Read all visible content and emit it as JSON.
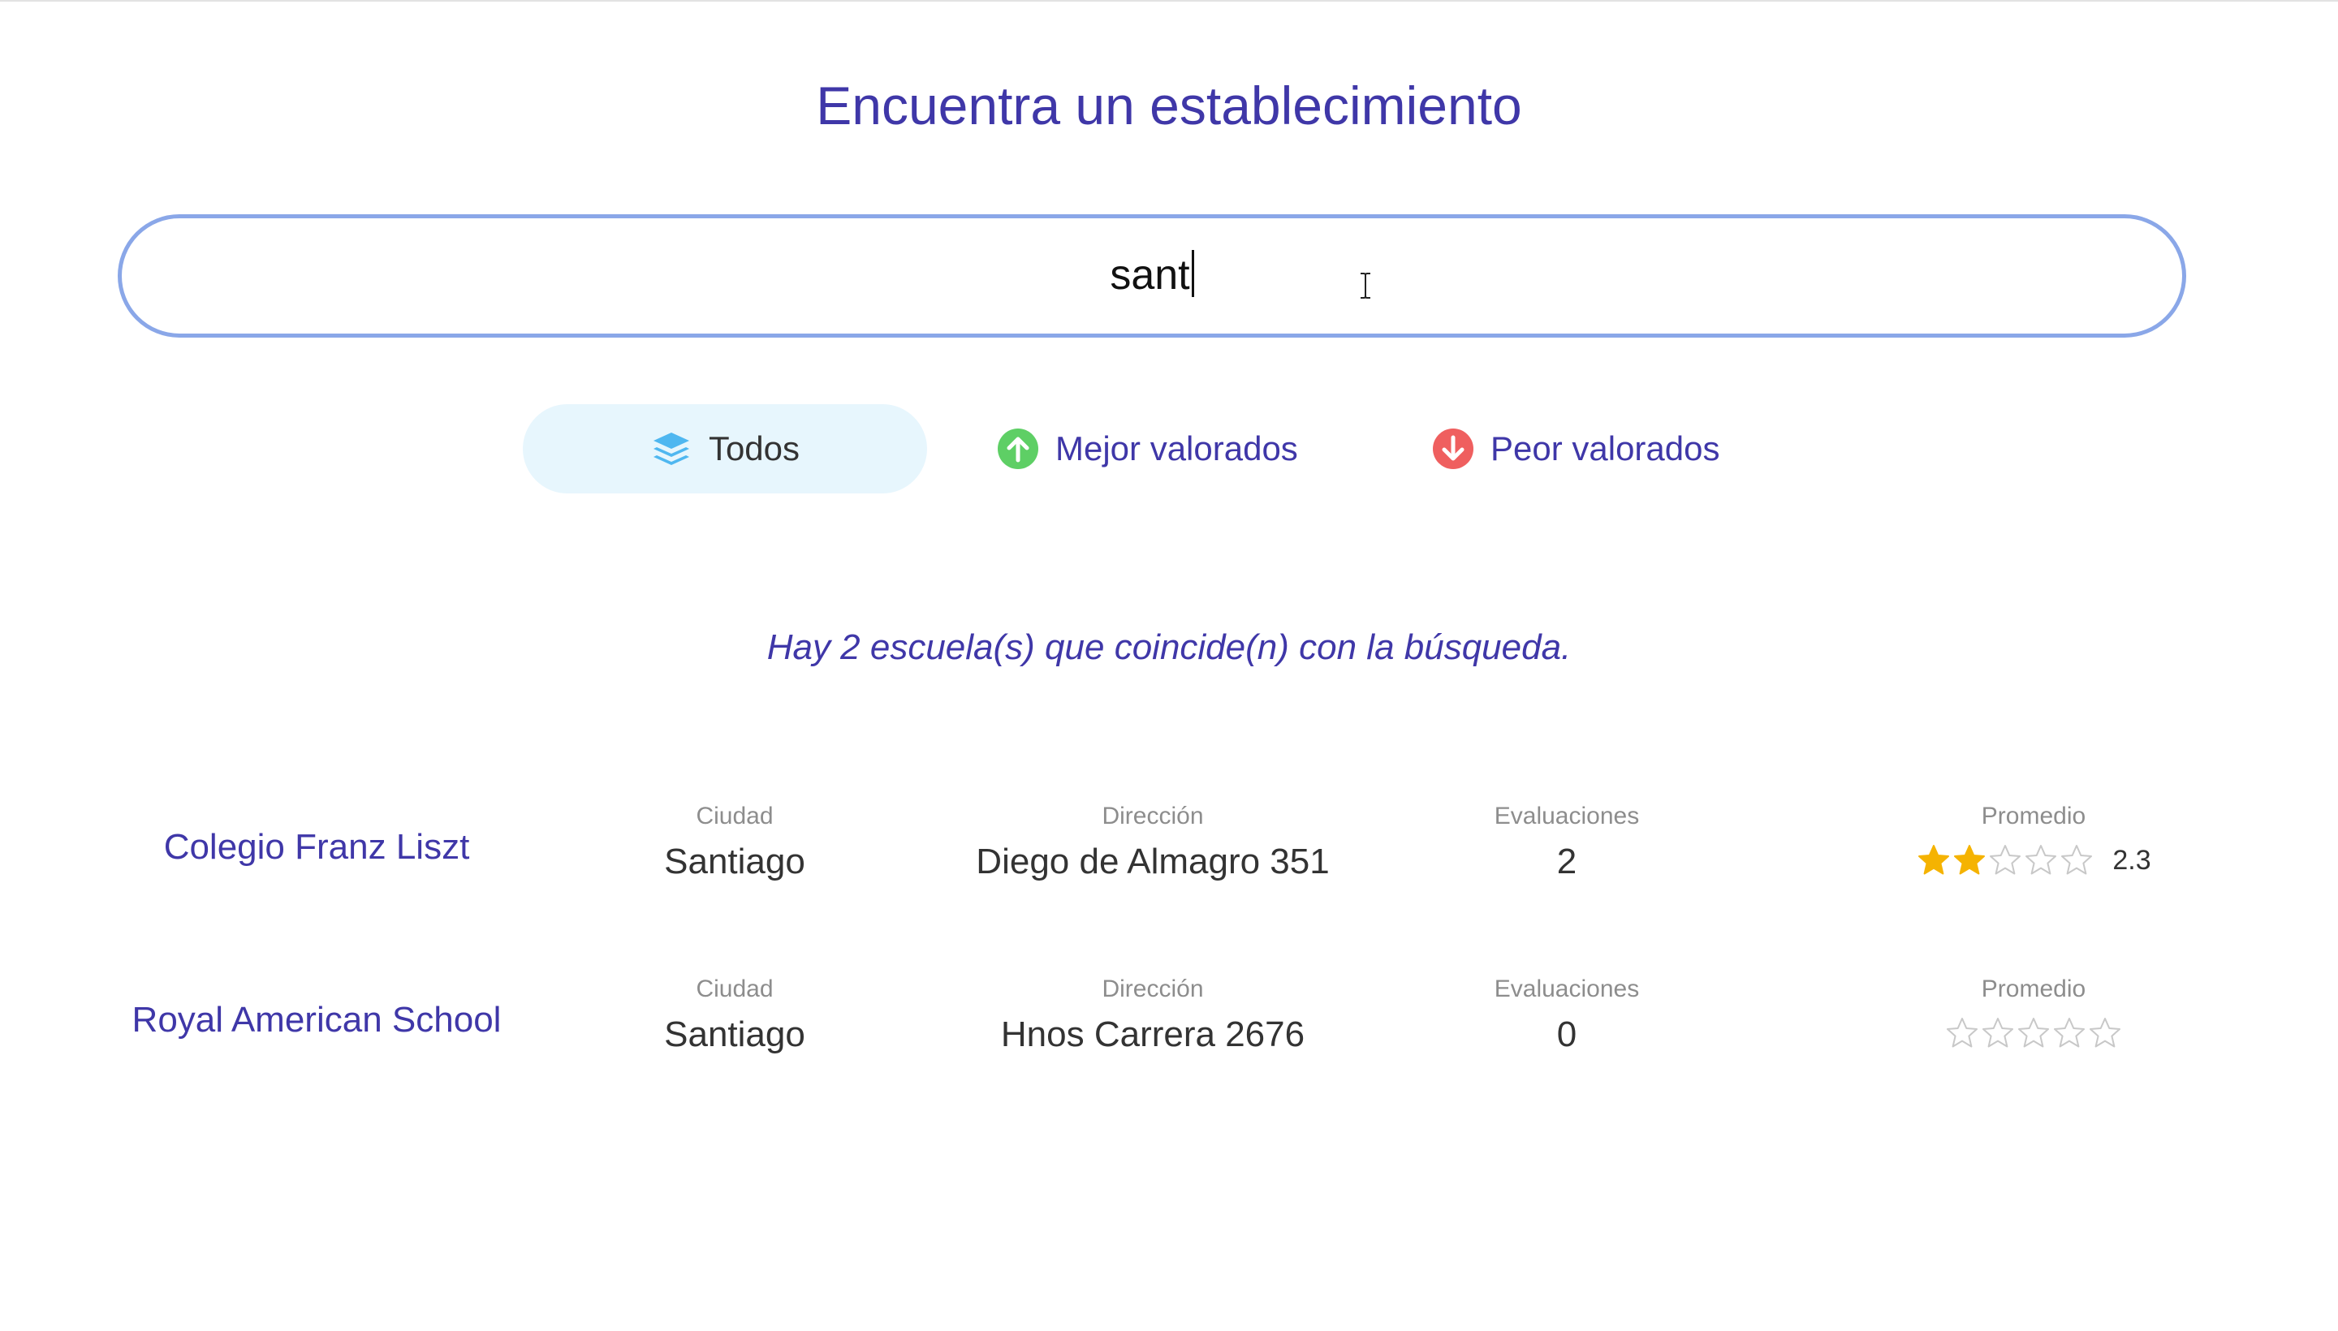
{
  "title": "Encuentra un establecimiento",
  "search": {
    "value": "sant"
  },
  "filters": [
    {
      "label": "Todos",
      "icon": "layers-icon",
      "color": "#4fb7f0",
      "active": true
    },
    {
      "label": "Mejor valorados",
      "icon": "arrow-up-circle-icon",
      "color": "#5ecf65",
      "active": false
    },
    {
      "label": "Peor valorados",
      "icon": "arrow-down-circle-icon",
      "color": "#ef5f5f",
      "active": false
    }
  ],
  "result_text": "Hay 2 escuela(s) que coincide(n) con la búsqueda.",
  "columns": {
    "city": "Ciudad",
    "address": "Dirección",
    "evaluations": "Evaluaciones",
    "average": "Promedio"
  },
  "schools": [
    {
      "name": "Colegio Franz Liszt",
      "city": "Santiago",
      "address": "Diego de Almagro 351",
      "evaluations": "2",
      "rating": 2.3,
      "rating_label": "2.3",
      "filled_stars": 2
    },
    {
      "name": "Royal American School",
      "city": "Santiago",
      "address": "Hnos Carrera 2676",
      "evaluations": "0",
      "rating": 0,
      "rating_label": "",
      "filled_stars": 0
    }
  ],
  "colors": {
    "accent": "#3f37a8",
    "search_border": "#8aa7e8",
    "star_filled": "#f5b301",
    "star_empty": "#c8c8c8"
  }
}
